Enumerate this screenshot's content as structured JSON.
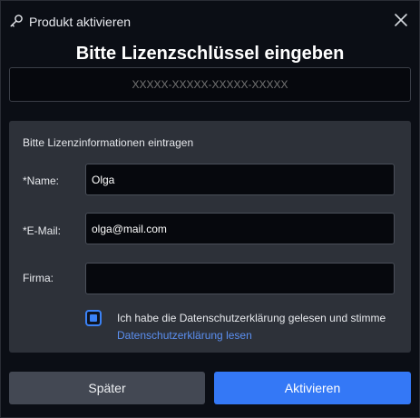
{
  "window": {
    "title": "Produkt aktivieren",
    "icons": {
      "app": "key-icon",
      "close": "close-icon"
    }
  },
  "heading": "Bitte Lizenzschlüssel eingeben",
  "license_key": {
    "placeholder": "XXXXX-XXXXX-XXXXX-XXXXX",
    "value": ""
  },
  "form": {
    "caption": "Bitte Lizenzinformationen eintragen",
    "name": {
      "label": "*Name:",
      "value": "Olga"
    },
    "email": {
      "label": "*E-Mail:",
      "value": "olga@mail.com"
    },
    "company": {
      "label": "Firma:",
      "value": ""
    },
    "consent": {
      "checked": true,
      "text": "Ich habe die Datenschutzerklärung gelesen und stimme",
      "link": "Datenschutzerklärung lesen"
    }
  },
  "buttons": {
    "later": "Später",
    "activate": "Aktivieren"
  },
  "colors": {
    "accent": "#3478f6",
    "link": "#5b8ff0",
    "panel": "#2d3139",
    "background": "#0b0e15"
  }
}
